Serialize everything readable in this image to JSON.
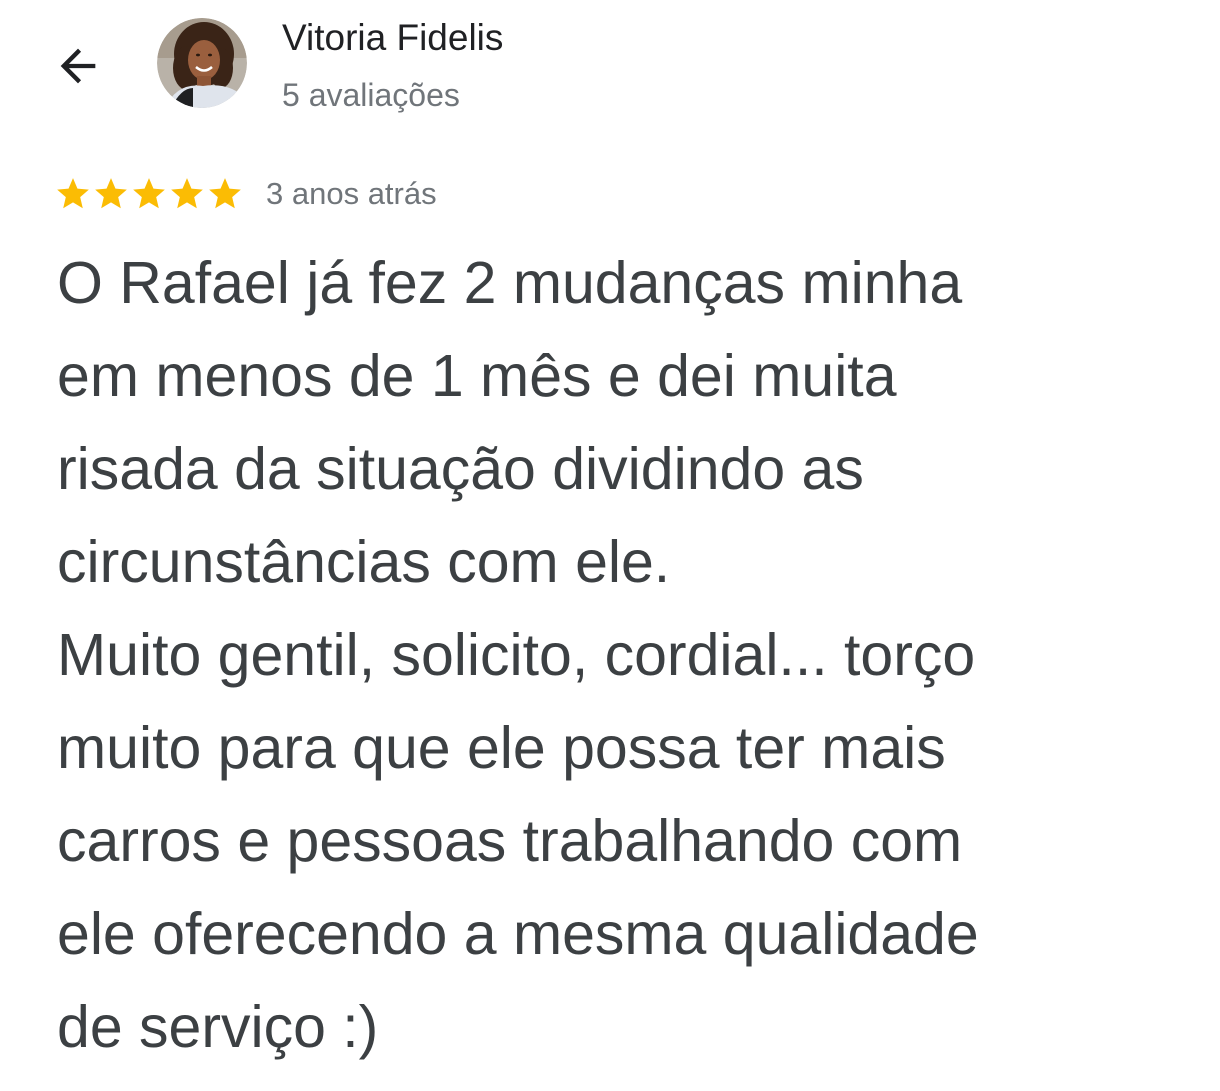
{
  "header": {
    "back_icon": "arrow-left-icon",
    "avatar_icon": "user-photo-avatar",
    "author_name": "Vitoria Fidelis",
    "review_count": "5 avaliações"
  },
  "review": {
    "rating": 5,
    "rating_max": 5,
    "star_icon": "star-icon",
    "star_color": "#fbbc04",
    "date": "3 anos atrás",
    "lines": [
      "O Rafael já fez 2 mudanças minha",
      "em menos de 1 mês e dei muita",
      "risada da situação dividindo as",
      "circunstâncias com ele.",
      "Muito gentil, solicito, cordial... torço",
      "muito para que ele possa ter mais",
      "carros e pessoas trabalhando com",
      "ele oferecendo a mesma qualidade",
      "de serviço :)"
    ]
  },
  "colors": {
    "text_primary": "#202124",
    "text_body": "#3c4043",
    "text_secondary": "#70757a",
    "background": "#ffffff"
  }
}
